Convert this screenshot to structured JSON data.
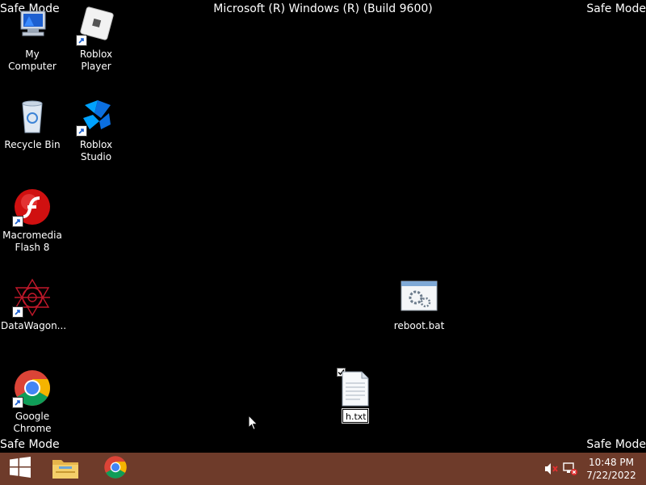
{
  "os": {
    "banner_title": "Microsoft (R) Windows (R) (Build 9600)",
    "mode_label": "Safe Mode"
  },
  "desktop": {
    "icons": [
      {
        "label": "My Computer",
        "icon": "computer-icon",
        "shortcut": false
      },
      {
        "label": "Roblox Player",
        "icon": "roblox-player-icon",
        "shortcut": true
      },
      {
        "label": "Recycle Bin",
        "icon": "recycle-bin-icon",
        "shortcut": false
      },
      {
        "label": "Roblox Studio",
        "icon": "roblox-studio-icon",
        "shortcut": true
      },
      {
        "label": "Macromedia Flash 8",
        "icon": "flash-icon",
        "shortcut": true
      },
      {
        "label": "DataWagon...",
        "icon": "datawagon-icon",
        "shortcut": true
      },
      {
        "label": "reboot.bat",
        "icon": "batch-file-icon",
        "shortcut": false
      },
      {
        "label": "Google Chrome",
        "icon": "chrome-icon",
        "shortcut": true
      }
    ],
    "renaming_file": {
      "value": "h.txt",
      "icon": "text-file-icon",
      "checked": true
    }
  },
  "taskbar": {
    "background": "#6e3b2a",
    "buttons": [
      "start-icon",
      "file-explorer-icon",
      "chrome-icon"
    ],
    "tray": [
      "volume-muted-icon",
      "network-disconnected-icon"
    ],
    "clock": {
      "time": "10:48 PM",
      "date": "7/22/2022"
    }
  }
}
